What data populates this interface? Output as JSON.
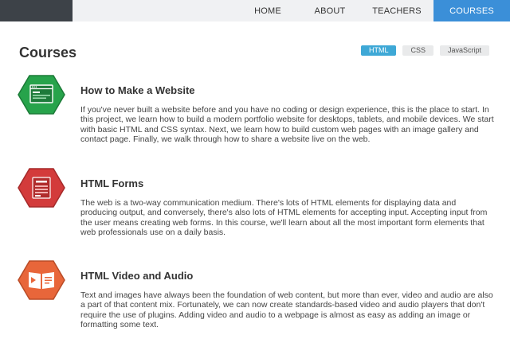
{
  "nav": {
    "home": "HOME",
    "about": "ABOUT",
    "teachers": "TEACHERS",
    "courses": "COURSES"
  },
  "page_title": "Courses",
  "filters": [
    "HTML",
    "CSS",
    "JavaScript"
  ],
  "active_filter": "HTML",
  "colors": {
    "accent_blue": "#3b8fd8",
    "filter_active": "#3ea8d6",
    "badge_green": "#27a34b",
    "badge_red": "#d33b3b",
    "badge_orange": "#e8663a"
  },
  "courses": [
    {
      "title": "How to Make a Website",
      "icon": "website-icon",
      "description": "If you've never built a website before and you have no coding or design experience, this is the place to start. In this project, we learn how to build a modern portfolio website for desktops, tablets, and mobile devices. We start with basic HTML and CSS syntax. Next, we learn how to build custom web pages with an image gallery and contact page. Finally, we walk through how to share a website live on the web."
    },
    {
      "title": "HTML Forms",
      "icon": "form-icon",
      "description": "The web is a two-way communication medium. There's lots of HTML elements for displaying data and producing output, and conversely, there's also lots of HTML elements for accepting input. Accepting input from the user means creating web forms. In this course, we'll learn about all the most important form elements that web professionals use on a daily basis."
    },
    {
      "title": "HTML Video and Audio",
      "icon": "video-icon",
      "description": "Text and images have always been the foundation of web content, but more than ever, video and audio are also a part of that content mix. Fortunately, we can now create standards-based video and audio players that don't require the use of plugins. Adding video and audio to a webpage is almost as easy as adding an image or formatting some text."
    }
  ]
}
